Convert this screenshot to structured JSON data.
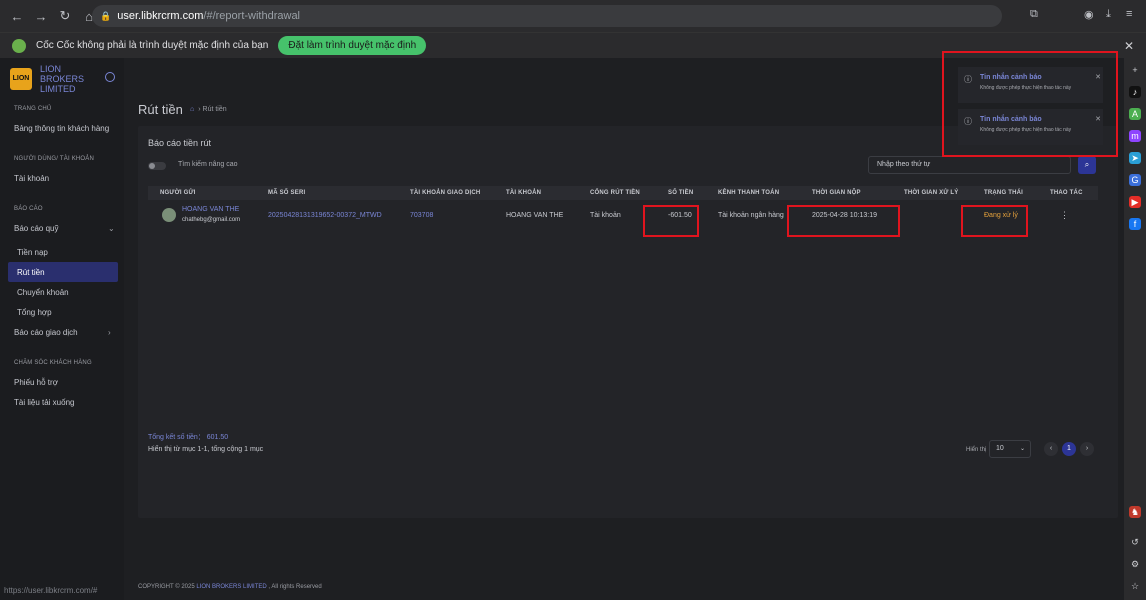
{
  "browser": {
    "url_domain": "user.libkrcrm.com",
    "url_path": "/#/report-withdrawal",
    "infobar_text": "Cốc Cốc không phải là trình duyệt mặc định của bạn",
    "infobar_button": "Đặt làm trình duyệt mặc định",
    "status_url": "https://user.libkrcrm.com/#"
  },
  "brand": {
    "name": "LION BROKERS LIMITED",
    "mark": "LION"
  },
  "sidebar": {
    "sec1": "TRANG CHỦ",
    "item_dashboard": "Bảng thông tin khách hàng",
    "sec2": "NGƯỜI DÙNG/ TÀI KHOẢN",
    "item_account": "Tài khoản",
    "sec3": "BÁO CÁO",
    "item_fund_report": "Báo cáo quỹ",
    "item_deposit": "Tiền nạp",
    "item_withdraw": "Rút tiền",
    "item_transfer": "Chuyển khoản",
    "item_summary": "Tổng hợp",
    "item_trade_report": "Báo cáo giao dịch",
    "sec4": "CHĂM SÓC KHÁCH HÀNG",
    "item_ticket": "Phiếu hỗ trợ",
    "item_docs": "Tài liệu tải xuống"
  },
  "page": {
    "title": "Rút tiền",
    "crumb": "Rút tiền",
    "card_title": "Báo cáo tiền rút",
    "advanced_search": "Tìm kiếm nâng cao",
    "search_placeholder": "Nhập theo thứ tự"
  },
  "table": {
    "headers": [
      "NGƯỜI GỬI",
      "MÃ SỐ SERI",
      "TÀI KHOẢN GIAO DỊCH",
      "TÀI KHOẢN",
      "CỔNG RÚT TIỀN",
      "SỐ TIỀN",
      "KÊNH THANH TOÁN",
      "THỜI GIAN NỘP",
      "THỜI GIAN XỬ LÝ",
      "TRẠNG THÁI",
      "THAO TÁC"
    ],
    "row": {
      "sender_name": "HOANG VAN THE",
      "sender_email": "chathebg@gmail.com",
      "serial": "20250428131319652-00372_MTWD",
      "trading_account": "703708",
      "account": "HOANG VAN THE",
      "gateway": "Tài khoản",
      "amount": "-601.50",
      "channel": "Tài khoản ngân hàng",
      "submit_time": "2025-04-28 10:13:19",
      "process_time": "",
      "status": "Đang xử lý",
      "action": "⋮"
    }
  },
  "summary": {
    "total": "Tổng kết số tiền： 601.50",
    "showing": "Hiển thị từ mục 1-1, tổng cộng 1 mục",
    "page_size_label": "Hiển thị",
    "page_size": "10",
    "current_page": "1"
  },
  "footer": {
    "prefix": "COPYRIGHT © 2025",
    "company": "LION BROKERS LIMITED",
    "suffix": ", All rights Reserved"
  },
  "notifications": [
    {
      "title": "Tin nhắn cảnh báo",
      "message": "Không được phép thực hiện thao tác này"
    },
    {
      "title": "Tin nhắn cảnh báo",
      "message": "Không được phép thực hiện thao tác này"
    }
  ]
}
